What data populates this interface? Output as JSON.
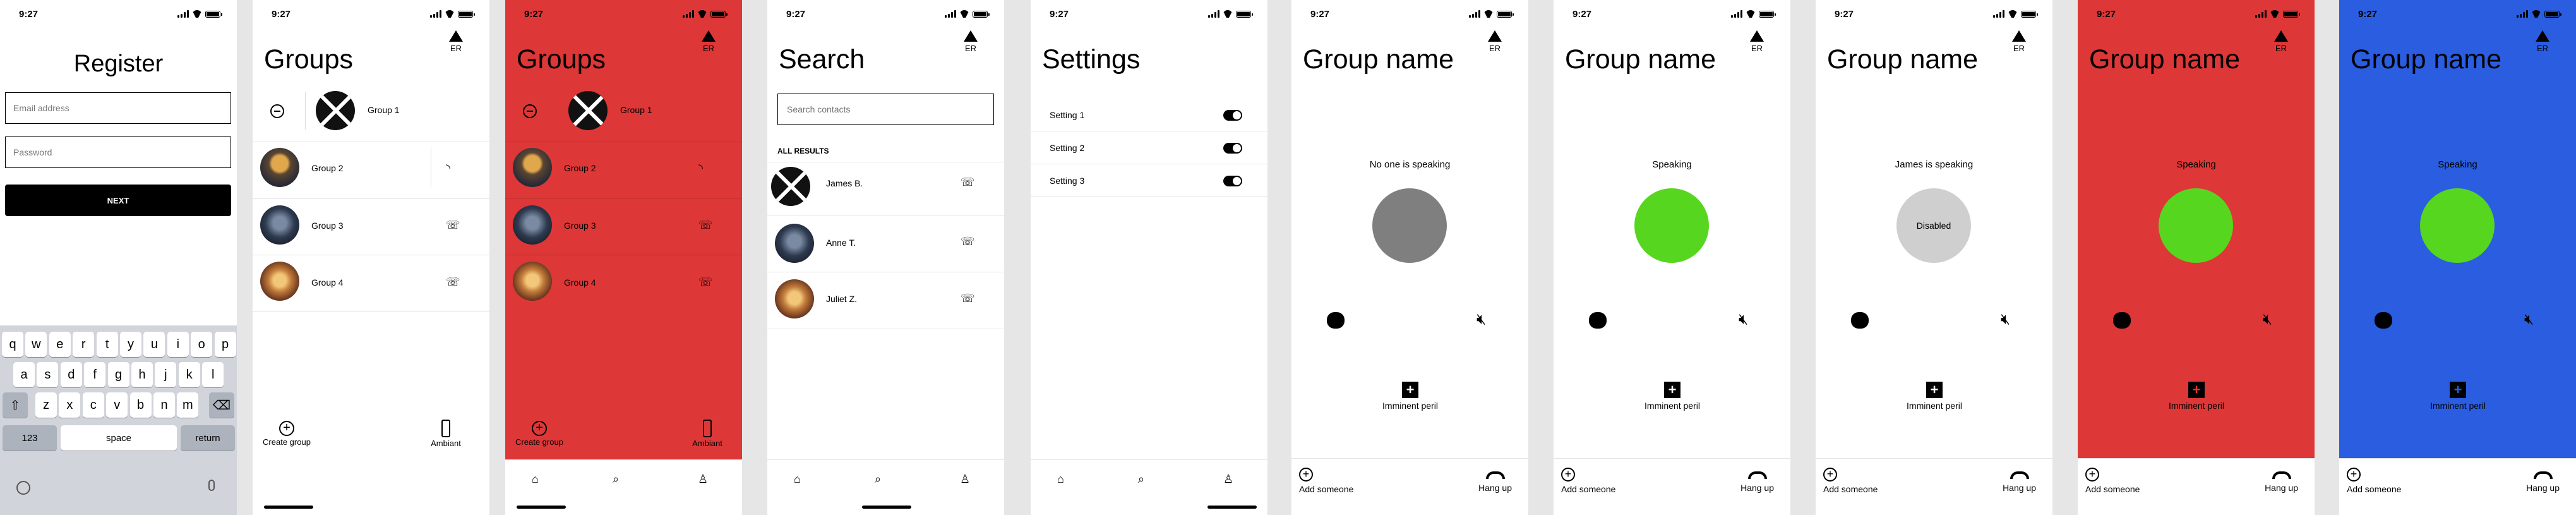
{
  "status_time": "9:27",
  "er_label": "ER",
  "colors": {
    "accent_red": "#dd3737",
    "accent_blue": "#2a5de0",
    "speaking_green": "#57d61f",
    "idle_grey": "#7f7f7f",
    "disabled_grey": "#cfcfcf"
  },
  "register": {
    "title": "Register",
    "email_placeholder": "Email address",
    "password_placeholder": "Password",
    "next_label": "NEXT",
    "keyboard_row1": [
      "q",
      "w",
      "e",
      "r",
      "t",
      "y",
      "u",
      "i",
      "o",
      "p"
    ],
    "keyboard_row2": [
      "a",
      "s",
      "d",
      "f",
      "g",
      "h",
      "j",
      "k",
      "l"
    ],
    "keyboard_row3": [
      "z",
      "x",
      "c",
      "v",
      "b",
      "n",
      "m"
    ],
    "key_123": "123",
    "key_space": "space",
    "key_return": "return"
  },
  "groups": {
    "title": "Groups",
    "items": [
      {
        "label": "Group 1"
      },
      {
        "label": "Group 2"
      },
      {
        "label": "Group 3"
      },
      {
        "label": "Group 4"
      }
    ],
    "create_label": "Create group",
    "ambiant_label": "Ambiant"
  },
  "search": {
    "title": "Search",
    "placeholder": "Search contacts",
    "section_header": "ALL RESULTS",
    "results": [
      {
        "name": "James B."
      },
      {
        "name": "Anne T."
      },
      {
        "name": "Juliet Z."
      }
    ]
  },
  "settings": {
    "title": "Settings",
    "items": [
      {
        "label": "Setting 1"
      },
      {
        "label": "Setting 2"
      },
      {
        "label": "Setting 3"
      }
    ]
  },
  "call": {
    "title": "Group name",
    "status_none": "No one is speaking",
    "status_speaking": "Speaking",
    "status_james": "James is speaking",
    "disabled_label": "Disabled",
    "imminent_label": "Imminent peril",
    "add_label": "Add someone",
    "hangup_label": "Hang up"
  }
}
